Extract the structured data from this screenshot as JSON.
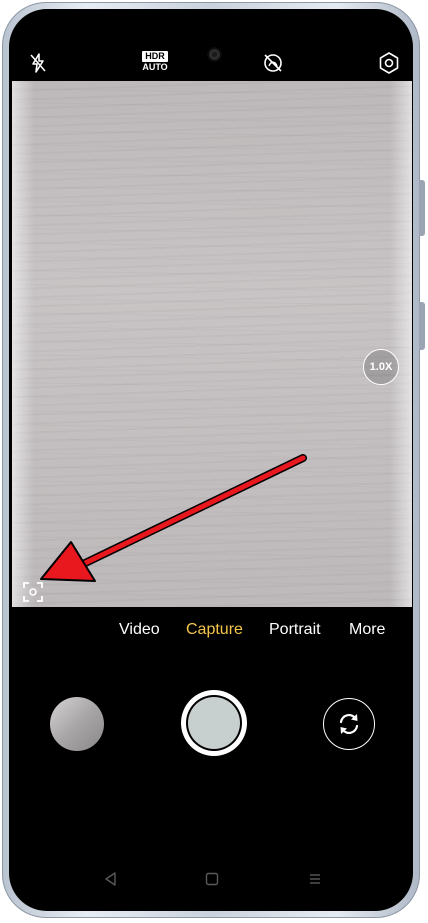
{
  "camera": {
    "zoom_level": "1.0X",
    "hdr_label": "HDR",
    "hdr_mode": "AUTO"
  },
  "modes": [
    {
      "label": "Video",
      "active": false
    },
    {
      "label": "Capture",
      "active": true
    },
    {
      "label": "Portrait",
      "active": false
    },
    {
      "label": "More",
      "active": false
    }
  ],
  "colors": {
    "active_mode": "#f3c64a",
    "annotation_arrow": "#e8181e",
    "icon": "#ffffff"
  },
  "icons": {
    "flash": "flash-off-icon",
    "hdr": "hdr-auto-icon",
    "filter": "filter-off-icon",
    "settings": "settings-hexagon-icon",
    "focus": "focus-frame-icon",
    "switch": "switch-camera-icon",
    "nav_back": "back-triangle-icon",
    "nav_home": "home-square-icon",
    "nav_menu": "menu-lines-icon"
  }
}
